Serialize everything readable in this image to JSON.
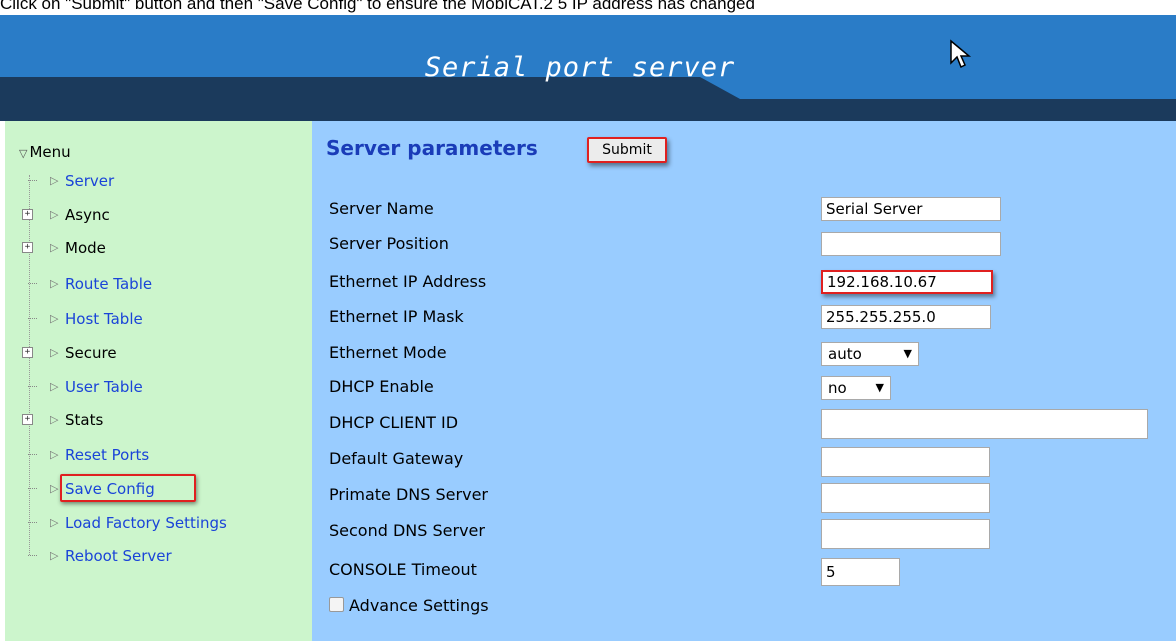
{
  "instruction_text": "Click on \"Submit\" button and then \"Save Config\" to ensure the MobiCAT.2 5 IP address has changed",
  "banner": {
    "title": "Serial port server"
  },
  "sidebar": {
    "root_label": "Menu",
    "items": [
      {
        "label": "Server",
        "expandable": false,
        "link": true
      },
      {
        "label": "Async",
        "expandable": true,
        "link": false
      },
      {
        "label": "Mode",
        "expandable": true,
        "link": false
      },
      {
        "label": "Route Table",
        "expandable": false,
        "link": true
      },
      {
        "label": "Host Table",
        "expandable": false,
        "link": true
      },
      {
        "label": "Secure",
        "expandable": true,
        "link": false
      },
      {
        "label": "User Table",
        "expandable": false,
        "link": true
      },
      {
        "label": "Stats",
        "expandable": true,
        "link": false
      },
      {
        "label": "Reset Ports",
        "expandable": false,
        "link": true
      },
      {
        "label": "Save Config",
        "expandable": false,
        "link": true
      },
      {
        "label": "Load Factory Settings",
        "expandable": false,
        "link": true
      },
      {
        "label": "Reboot Server",
        "expandable": false,
        "link": true
      }
    ]
  },
  "main": {
    "heading": "Server parameters",
    "submit_label": "Submit",
    "fields": {
      "server_name": {
        "label": "Server Name",
        "value": "Serial Server"
      },
      "server_position": {
        "label": "Server Position",
        "value": ""
      },
      "ip_address": {
        "label": "Ethernet IP Address",
        "value": "192.168.10.67"
      },
      "ip_mask": {
        "label": "Ethernet IP Mask",
        "value": "255.255.255.0"
      },
      "ethernet_mode": {
        "label": "Ethernet Mode",
        "value": "auto"
      },
      "dhcp_enable": {
        "label": "DHCP Enable",
        "value": "no"
      },
      "dhcp_client_id": {
        "label": "DHCP CLIENT ID",
        "value": ""
      },
      "default_gateway": {
        "label": "Default Gateway",
        "value": ""
      },
      "primary_dns": {
        "label": "Primate DNS Server",
        "value": ""
      },
      "second_dns": {
        "label": "Second DNS Server",
        "value": ""
      },
      "console_timeout": {
        "label": "CONSOLE Timeout",
        "value": "5"
      }
    },
    "advance_settings_label": "Advance Settings"
  },
  "colors": {
    "banner": "#1f6bb3",
    "sidebar_bg": "#ccf5cc",
    "main_bg": "#99ccff",
    "heading": "#1a3cb8",
    "link": "#1a44d8",
    "highlight": "#e02020"
  },
  "icons": {
    "menu_toggle": "triangle-down-icon",
    "item_arrow": "triangle-right-icon",
    "expander": "plus-box-icon",
    "select_caret": "caret-down-icon",
    "cursor": "mouse-pointer-icon"
  }
}
